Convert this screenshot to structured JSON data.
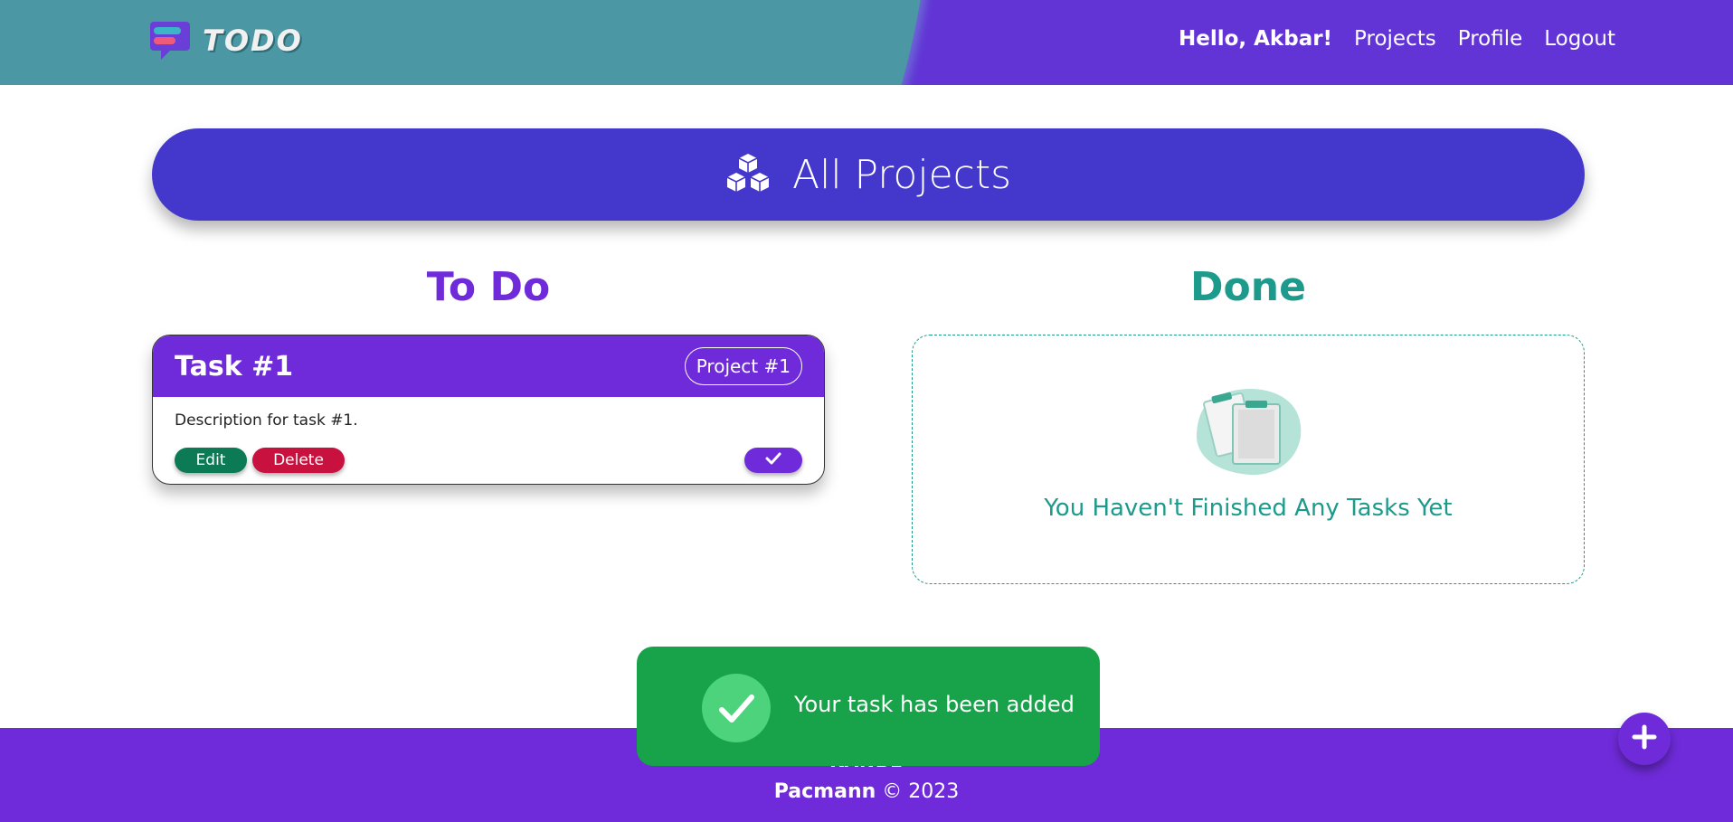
{
  "brand": {
    "logo_text": "TODO"
  },
  "nav": {
    "greeting": "Hello, Akbar!",
    "items": [
      "Projects",
      "Profile",
      "Logout"
    ]
  },
  "banner": {
    "title": "All Projects",
    "icon": "cubes-icon"
  },
  "columns": {
    "todo": {
      "title": "To Do",
      "tasks": [
        {
          "title": "Task #1",
          "project": "Project #1",
          "description": "Description for task #1.",
          "edit_label": "Edit",
          "delete_label": "Delete",
          "complete_icon": "check-icon"
        }
      ]
    },
    "done": {
      "title": "Done",
      "empty_message": "You Haven't Finished Any Tasks Yet",
      "empty_icon": "clipboards-illustration"
    }
  },
  "toast": {
    "message": "Your task has been added",
    "icon": "check-circle-icon"
  },
  "footer": {
    "partially_hidden_text": "KANBE",
    "brand": "Pacmann",
    "copyright": "© 2023"
  },
  "fab": {
    "icon": "plus-icon"
  },
  "colors": {
    "header_bg": "#6234d6",
    "header_teal": "#4b98a4",
    "banner_bg": "#4437cc",
    "primary_purple": "#6f2bd9",
    "teal": "#1c9a8c",
    "edit_green": "#0b7a55",
    "delete_red": "#c8113f",
    "toast_green": "#18a34a"
  }
}
